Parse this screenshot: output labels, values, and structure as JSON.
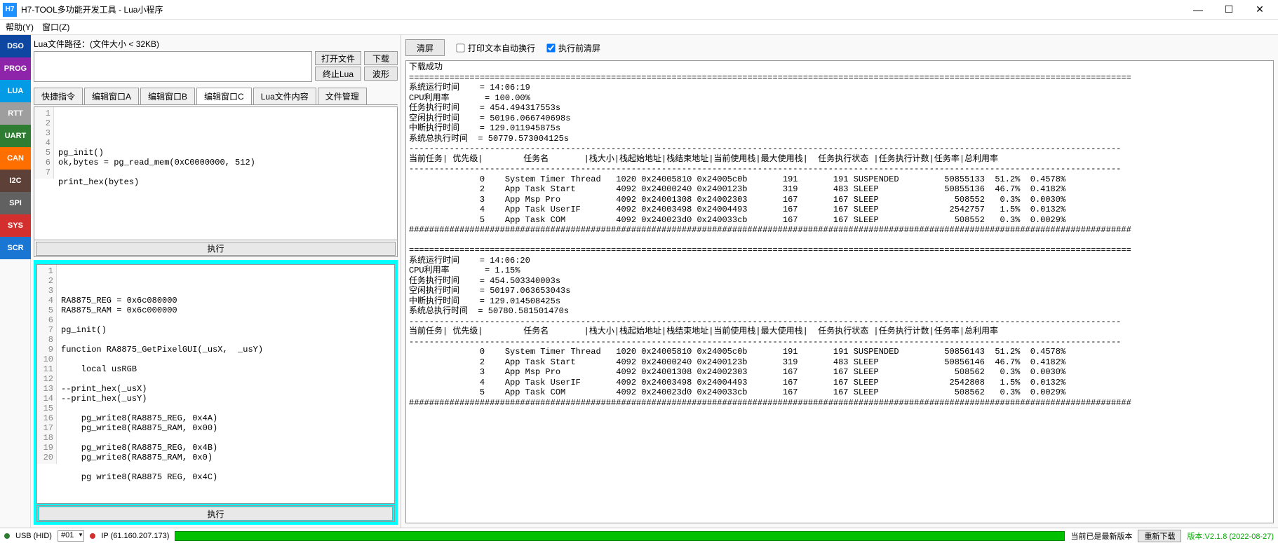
{
  "window": {
    "icon_text": "H7",
    "title": "H7-TOOL多功能开发工具 - Lua小程序"
  },
  "menubar": {
    "help": "帮助(Y)",
    "window": "窗口(Z)"
  },
  "sidebar": {
    "dso": "DSO",
    "prog": "PROG",
    "lua": "LUA",
    "rtt": "RTT",
    "uart": "UART",
    "can": "CAN",
    "i2c": "I2C",
    "spi": "SPI",
    "sys": "SYS",
    "scr": "SCR"
  },
  "file": {
    "label": "Lua文件路径：(文件大小 < 32KB)",
    "path": "",
    "open": "打开文件",
    "stop": "终止Lua",
    "download": "下载",
    "wave": "波形"
  },
  "tabs": {
    "t0": "快捷指令",
    "t1": "编辑窗口A",
    "t2": "编辑窗口B",
    "t3": "编辑窗口C",
    "t4": "Lua文件内容",
    "t5": "文件管理"
  },
  "editor1": {
    "lines": "1\n2\n3\n4\n5\n6\n7",
    "code": "\npg_init()\nok,bytes = pg_read_mem(0xC0000000, 512)\n\nprint_hex(bytes)\n\n"
  },
  "exec_label": "执行",
  "editor2": {
    "lines": "1\n2\n3\n4\n5\n6\n7\n8\n9\n10\n11\n12\n13\n14\n15\n16\n17\n18\n19\n20",
    "code": "RA8875_REG = 0x6c080000\nRA8875_RAM = 0x6c000000\n\npg_init()\n\nfunction RA8875_GetPixelGUI(_usX,  _usY)\n\n    local usRGB\n\n--print_hex(_usX)\n--print_hex(_usY)\n\n    pg_write8(RA8875_REG, 0x4A)\n    pg_write8(RA8875_RAM, 0x00)\n\n    pg_write8(RA8875_REG, 0x4B)\n    pg_write8(RA8875_RAM, 0x0)\n\n    pg write8(RA8875 REG, 0x4C)"
  },
  "right": {
    "clear": "清屏",
    "auto_wrap": "打印文本自动换行",
    "clear_before_exec": "执行前清屏",
    "output": "下载成功\n===============================================================================================================================================\n系统运行时间    = 14:06:19\nCPU利用率       = 100.00%\n任务执行时间    = 454.494317553s\n空闲执行时间    = 50196.066740698s\n中断执行时间    = 129.011945875s\n系统总执行时间  = 50779.573004125s\n---------------------------------------------------------------------------------------------------------------------------------------------\n当前任务| 优先级|        任务名       |栈大小|栈起始地址|栈结束地址|当前使用栈|最大使用栈|  任务执行状态 |任务执行计数|任务率|总利用率\n---------------------------------------------------------------------------------------------------------------------------------------------\n              0    System Timer Thread   1020 0x24005810 0x24005c0b       191       191 SUSPENDED         50855133  51.2%  0.4578%\n              2    App Task Start        4092 0x24000240 0x2400123b       319       483 SLEEP             50855136  46.7%  0.4182%\n              3    App Msp Pro           4092 0x24001308 0x24002303       167       167 SLEEP               508552   0.3%  0.0030%\n              4    App Task UserIF       4092 0x24003498 0x24004493       167       167 SLEEP              2542757   1.5%  0.0132%\n              5    App Task COM          4092 0x240023d0 0x240033cb       167       167 SLEEP               508552   0.3%  0.0029%\n###############################################################################################################################################\n\n===============================================================================================================================================\n系统运行时间    = 14:06:20\nCPU利用率       = 1.15%\n任务执行时间    = 454.503340003s\n空闲执行时间    = 50197.063653043s\n中断执行时间    = 129.014508425s\n系统总执行时间  = 50780.581501470s\n---------------------------------------------------------------------------------------------------------------------------------------------\n当前任务| 优先级|        任务名       |栈大小|栈起始地址|栈结束地址|当前使用栈|最大使用栈|  任务执行状态 |任务执行计数|任务率|总利用率\n---------------------------------------------------------------------------------------------------------------------------------------------\n              0    System Timer Thread   1020 0x24005810 0x24005c0b       191       191 SUSPENDED         50856143  51.2%  0.4578%\n              2    App Task Start        4092 0x24000240 0x2400123b       319       483 SLEEP             50856146  46.7%  0.4182%\n              3    App Msp Pro           4092 0x24001308 0x24002303       167       167 SLEEP               508562   0.3%  0.0030%\n              4    App Task UserIF       4092 0x24003498 0x24004493       167       167 SLEEP              2542808   1.5%  0.0132%\n              5    App Task COM          4092 0x240023d0 0x240033cb       167       167 SLEEP               508562   0.3%  0.0029%\n###############################################################################################################################################"
  },
  "status": {
    "usb": "USB (HID)",
    "combo": "#01",
    "ip": "IP (61.160.207.173)",
    "latest": "当前已是最新版本",
    "redownload": "重新下载",
    "version": "版本:V2.1.8 (2022-08-27)"
  }
}
